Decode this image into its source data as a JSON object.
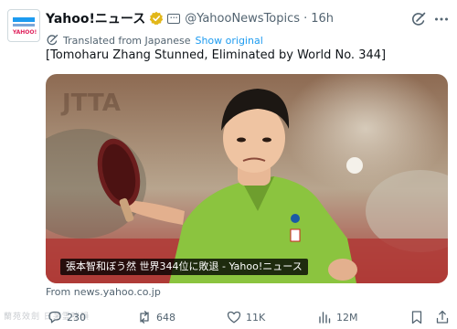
{
  "author": {
    "display_name": "Yahoo!ニュース",
    "handle": "@YahooNewsTopics",
    "timestamp": "16h",
    "avatar_brand": "YAHOO!",
    "affiliate_badge": "•••"
  },
  "translation": {
    "label": "Translated from Japanese",
    "show_original": "Show original"
  },
  "post": {
    "text": "[Tomoharu Zhang Stunned, Eliminated by World No. 344]"
  },
  "media": {
    "caption": "張本智和ぼう然 世界344位に敗退 - Yahoo!ニュース"
  },
  "source": "From news.yahoo.co.jp",
  "actions": {
    "replies": "230",
    "reposts": "648",
    "likes": "11K",
    "views": "12M"
  },
  "watermark": "蘭苑效劍 日茅霊咪韻",
  "icons": {
    "verified": "verified-badge-icon",
    "grok": "grok-icon",
    "more": "more-icon",
    "translate": "translate-icon",
    "reply": "reply-icon",
    "repost": "repost-icon",
    "like": "like-icon",
    "views": "views-icon",
    "bookmark": "bookmark-icon",
    "share": "share-icon"
  },
  "colors": {
    "accent": "#1d9bf0",
    "text": "#0f1419",
    "muted": "#536471",
    "verified_gold": "#e2b719"
  }
}
